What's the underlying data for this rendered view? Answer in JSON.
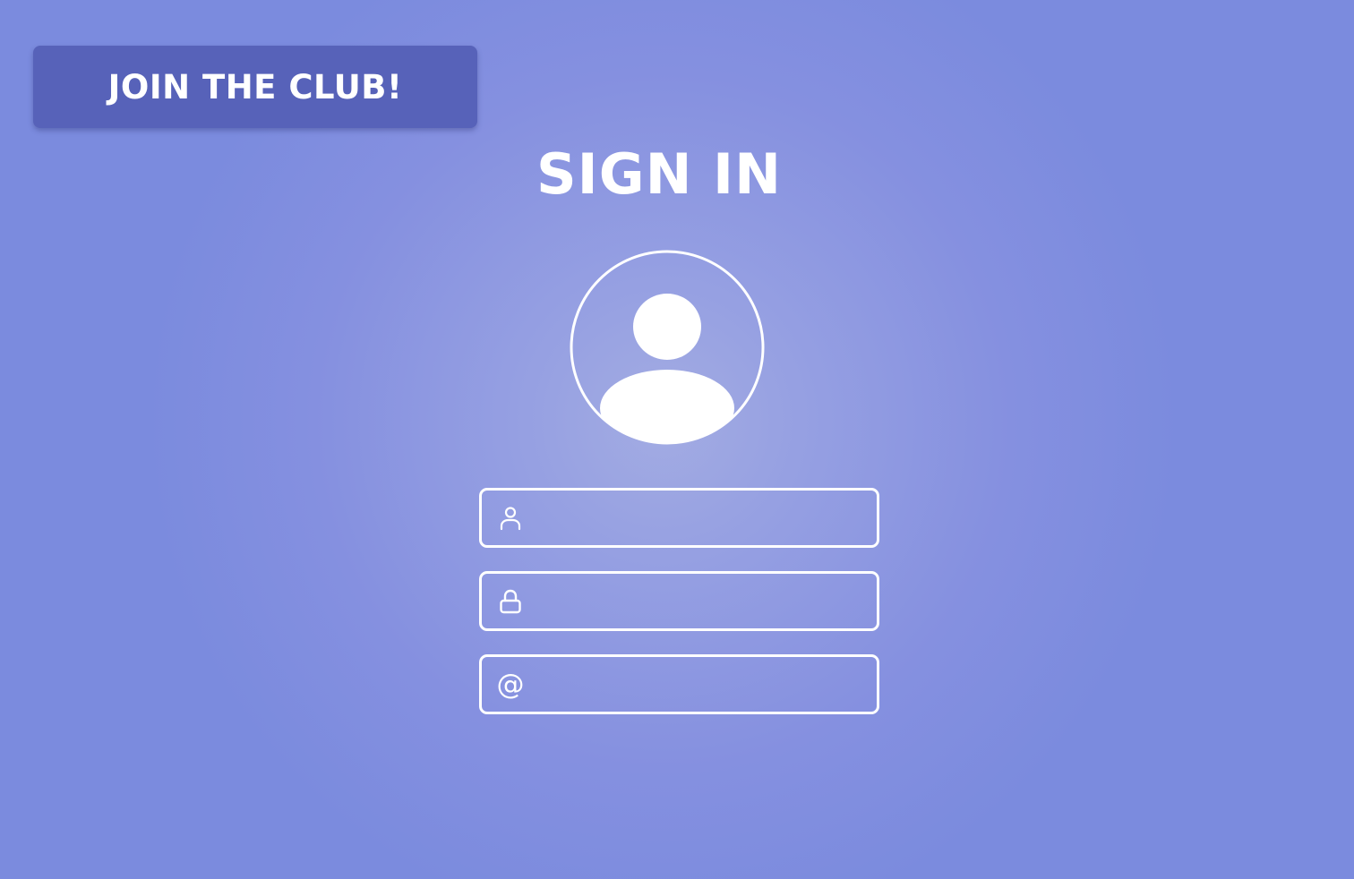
{
  "join_button": {
    "label": "JOIN THE CLUB!"
  },
  "title": "SIGN IN",
  "avatar": {
    "icon": "user-avatar-icon"
  },
  "fields": {
    "username": {
      "icon": "user-icon",
      "value": "",
      "placeholder": ""
    },
    "password": {
      "icon": "lock-icon",
      "value": "",
      "placeholder": ""
    },
    "email": {
      "icon": "at-sign-icon",
      "icon_glyph": "@",
      "value": "",
      "placeholder": ""
    }
  },
  "colors": {
    "background": "#7b8bde",
    "background_center": "#a3ace3",
    "button": "#5762b9",
    "foreground": "#ffffff"
  }
}
